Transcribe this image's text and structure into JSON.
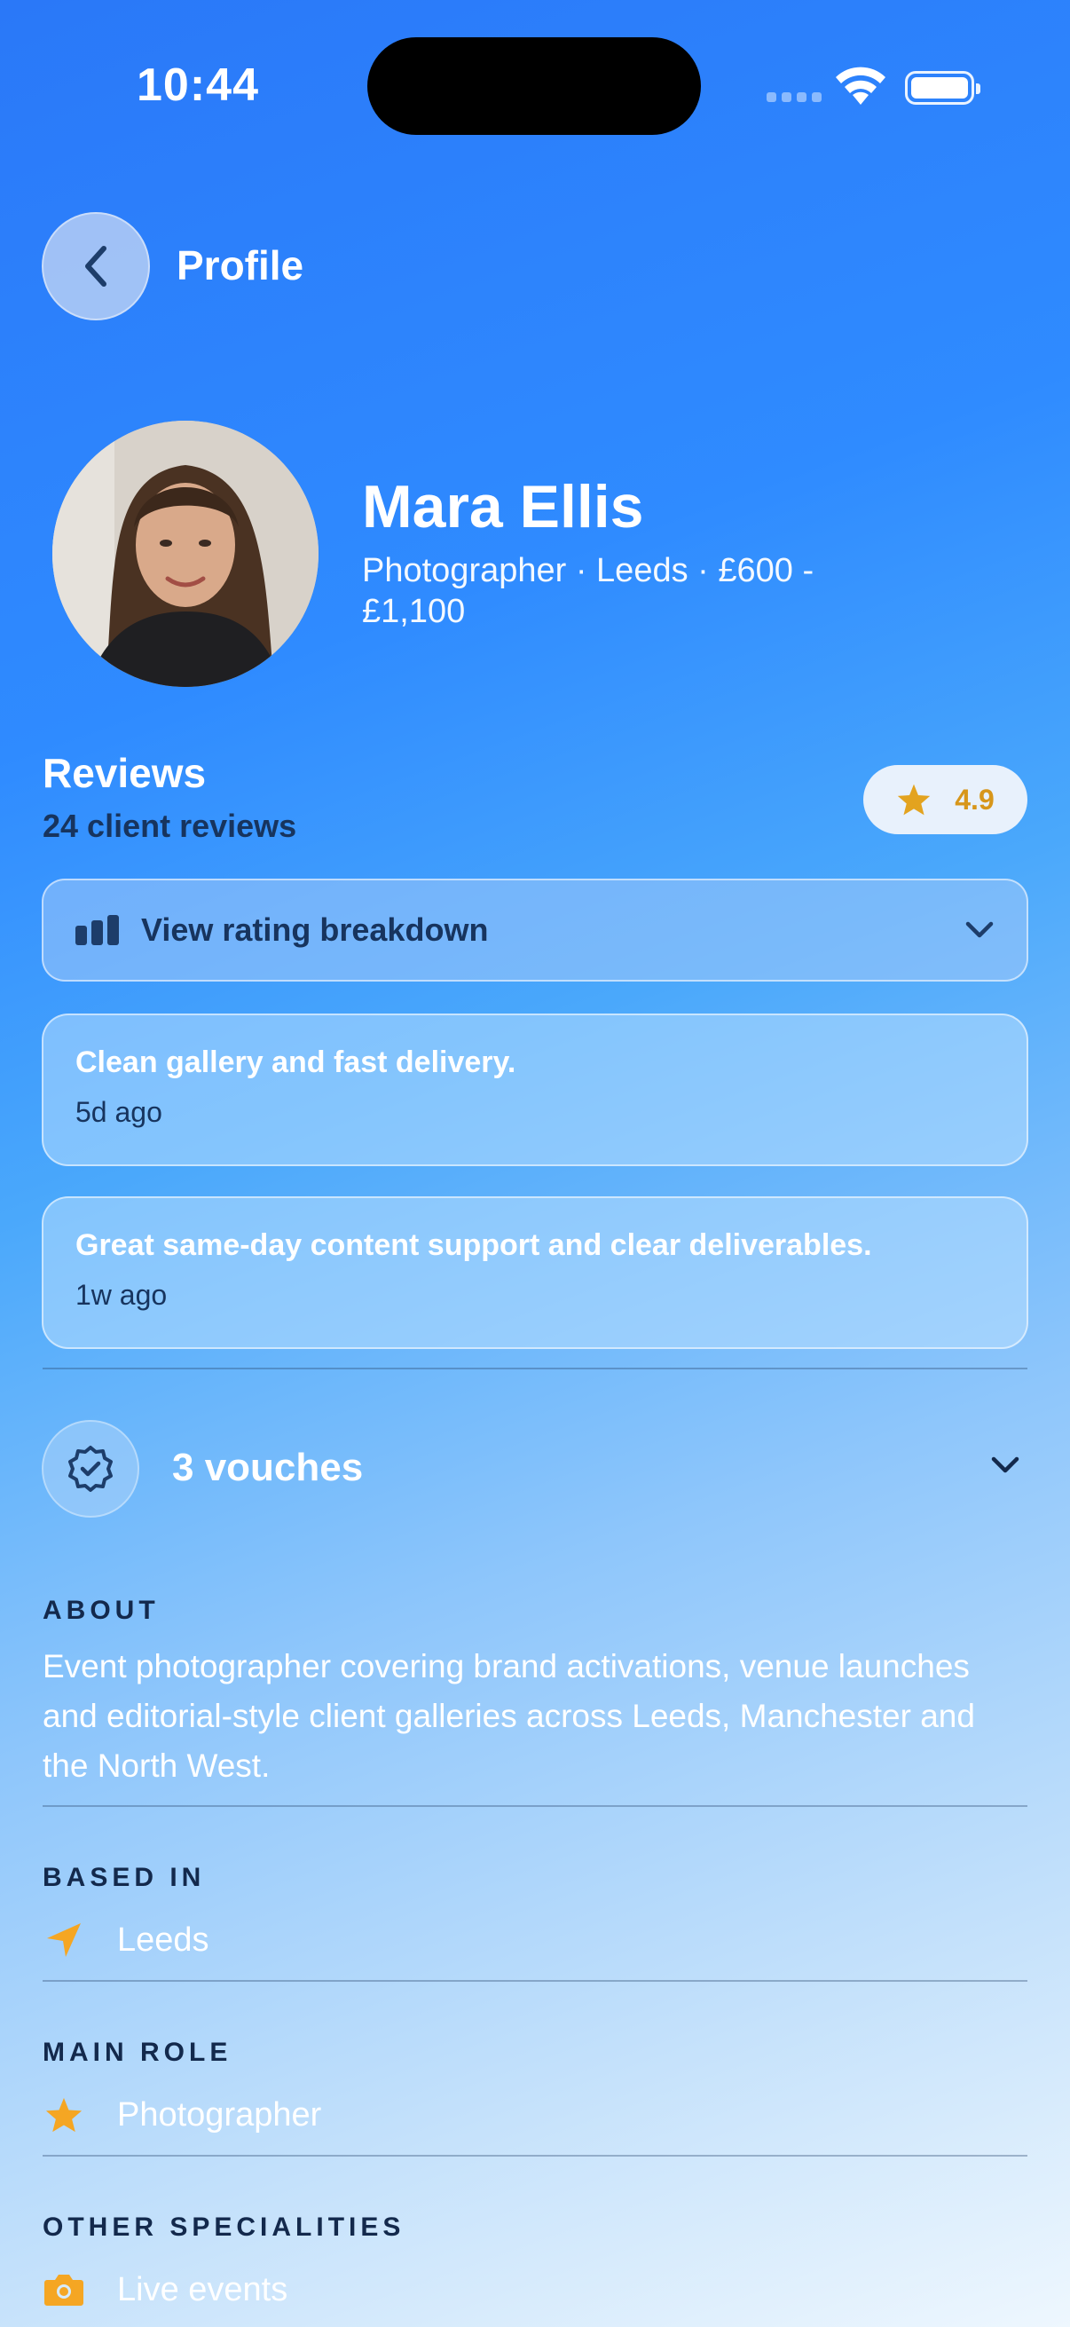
{
  "status_bar": {
    "time": "10:44"
  },
  "header": {
    "title": "Profile"
  },
  "profile": {
    "name": "Mara Ellis",
    "subtitle": "Photographer · Leeds · £600 - £1,100"
  },
  "reviews": {
    "title": "Reviews",
    "count_label": "24 client reviews",
    "rating": "4.9",
    "breakdown_label": "View rating breakdown",
    "items": [
      {
        "text": "Clean gallery and fast delivery.",
        "time": "5d ago"
      },
      {
        "text": "Great same-day content support and clear deliverables.",
        "time": "1w ago"
      }
    ]
  },
  "vouches": {
    "label": "3 vouches"
  },
  "about": {
    "label": "ABOUT",
    "text": "Event photographer covering brand activations, venue launches and editorial-style client galleries across Leeds, Manchester and the North West."
  },
  "based_in": {
    "label": "BASED IN",
    "value": "Leeds"
  },
  "main_role": {
    "label": "MAIN ROLE",
    "value": "Photographer"
  },
  "other_specialities": {
    "label": "OTHER SPECIALITIES",
    "items": [
      "Live events"
    ]
  },
  "colors": {
    "accent_orange": "#f5a623",
    "rating_gold": "#d7961a",
    "dark_text": "#17345e"
  }
}
